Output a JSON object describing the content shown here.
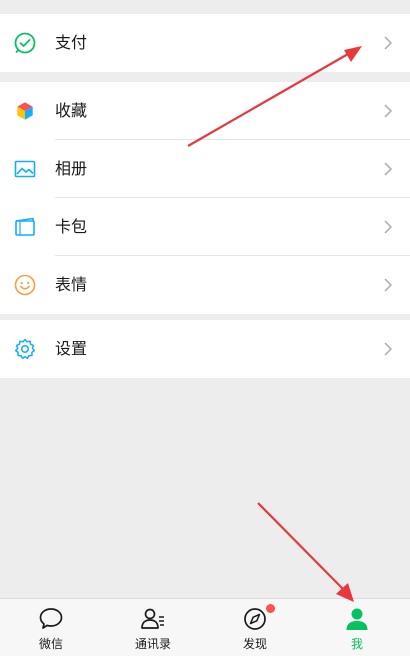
{
  "menu": {
    "pay": {
      "label": "支付",
      "icon": "wechat-pay-icon"
    },
    "group2": [
      {
        "label": "收藏",
        "icon": "favorites-cube-icon"
      },
      {
        "label": "相册",
        "icon": "photo-album-icon"
      },
      {
        "label": "卡包",
        "icon": "card-wallet-icon"
      },
      {
        "label": "表情",
        "icon": "sticker-smiley-icon"
      }
    ],
    "settings": {
      "label": "设置",
      "icon": "gear-icon"
    }
  },
  "tabbar": {
    "tabs": [
      {
        "label": "微信",
        "icon": "chat-bubble-icon"
      },
      {
        "label": "通讯录",
        "icon": "contacts-icon"
      },
      {
        "label": "发现",
        "icon": "compass-icon"
      },
      {
        "label": "我",
        "icon": "person-icon",
        "active": true
      }
    ]
  },
  "colors": {
    "accent_green": "#07c160",
    "arrow_red": "#e8383d",
    "background": "#ededed"
  }
}
